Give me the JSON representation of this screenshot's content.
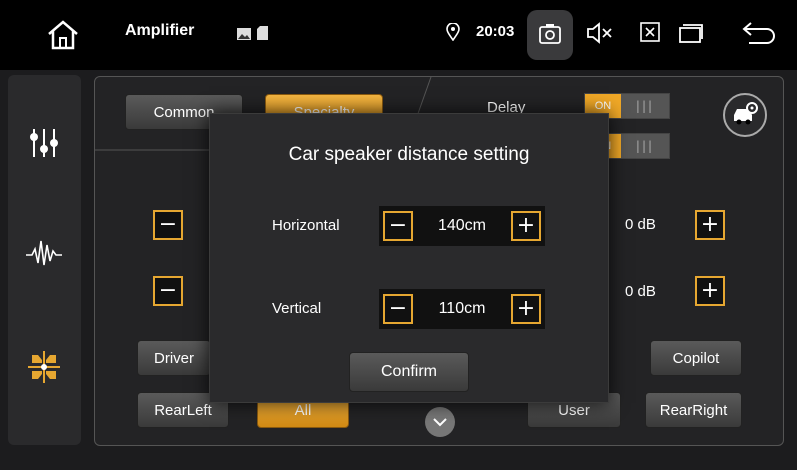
{
  "topbar": {
    "app_title": "Amplifier",
    "clock": "20:03",
    "icons": [
      "home-icon",
      "image-icon",
      "sd-card-icon",
      "location-pin-icon",
      "screenshot-icon",
      "mute-icon",
      "close-app-icon",
      "recent-apps-icon",
      "back-icon"
    ]
  },
  "sidebar": {
    "items": [
      "equalizer-icon",
      "waveform-icon",
      "balance-icon"
    ],
    "active_color": "#e6a731"
  },
  "panel": {
    "tabs": {
      "common": "Common",
      "specialty": "Specialty"
    },
    "delay_label": "Delay",
    "toggle_on": "ON",
    "db_values": [
      "0 dB",
      "0 dB"
    ],
    "positions": {
      "driver": "Driver",
      "copilot": "Copilot",
      "rear_left": "RearLeft",
      "all": "All",
      "user": "User",
      "rear_right": "RearRight"
    }
  },
  "modal": {
    "title": "Car speaker distance setting",
    "horizontal_label": "Horizontal",
    "horizontal_value": "140cm",
    "vertical_label": "Vertical",
    "vertical_value": "110cm",
    "confirm": "Confirm"
  },
  "colors": {
    "accent": "#e6a731",
    "background": "#1c1c1e",
    "topbar": "#000000"
  }
}
